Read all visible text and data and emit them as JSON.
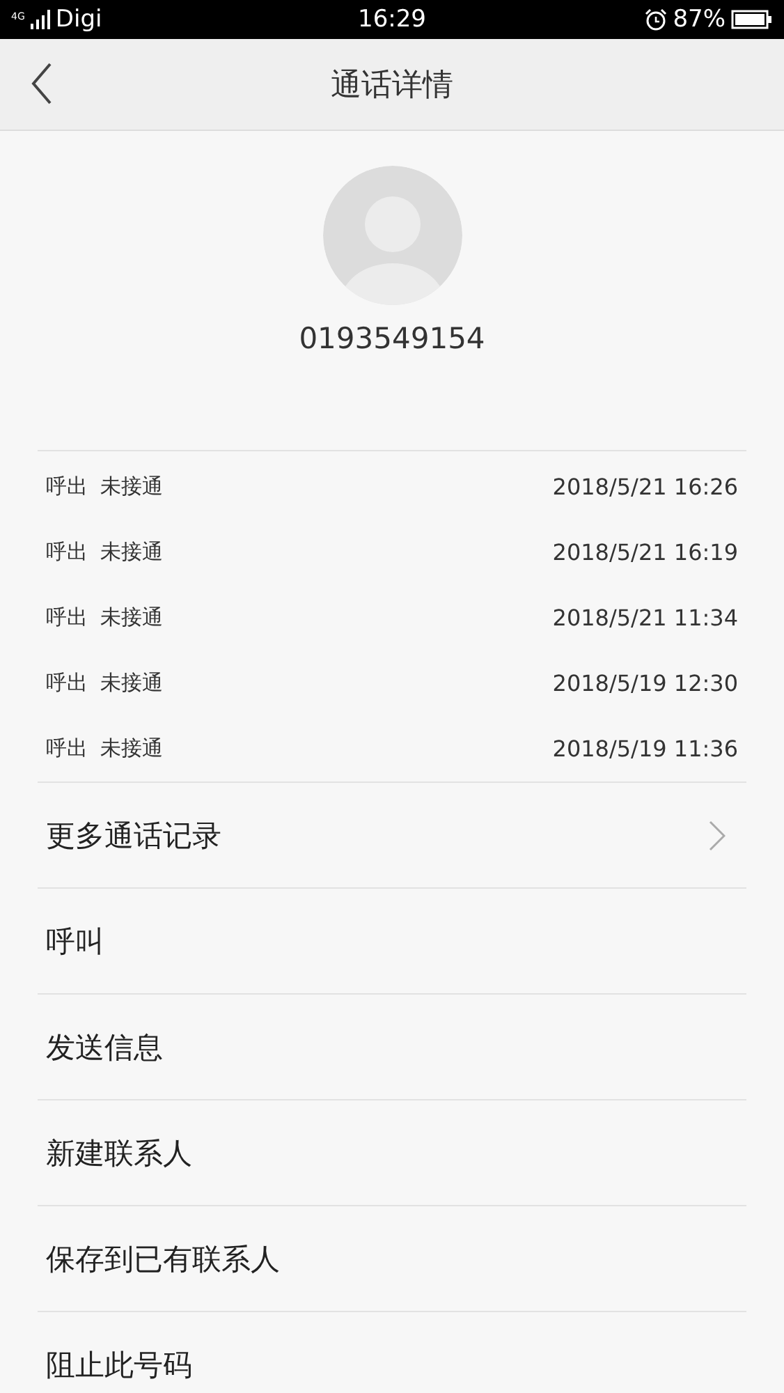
{
  "status_bar": {
    "carrier": "Digi",
    "network": "4G",
    "time": "16:29",
    "battery": "87%"
  },
  "header": {
    "title": "通话详情"
  },
  "contact": {
    "number": "0193549154"
  },
  "calls": [
    {
      "direction": "呼出",
      "status": "未接通",
      "time": "2018/5/21 16:26"
    },
    {
      "direction": "呼出",
      "status": "未接通",
      "time": "2018/5/21 16:19"
    },
    {
      "direction": "呼出",
      "status": "未接通",
      "time": "2018/5/21 11:34"
    },
    {
      "direction": "呼出",
      "status": "未接通",
      "time": "2018/5/19 12:30"
    },
    {
      "direction": "呼出",
      "status": "未接通",
      "time": "2018/5/19 11:36"
    }
  ],
  "actions": [
    {
      "label": "更多通话记录",
      "chevron": true
    },
    {
      "label": "呼叫",
      "chevron": false
    },
    {
      "label": "发送信息",
      "chevron": false
    },
    {
      "label": "新建联系人",
      "chevron": false
    },
    {
      "label": "保存到已有联系人",
      "chevron": false
    },
    {
      "label": "阻止此号码",
      "chevron": false
    }
  ]
}
